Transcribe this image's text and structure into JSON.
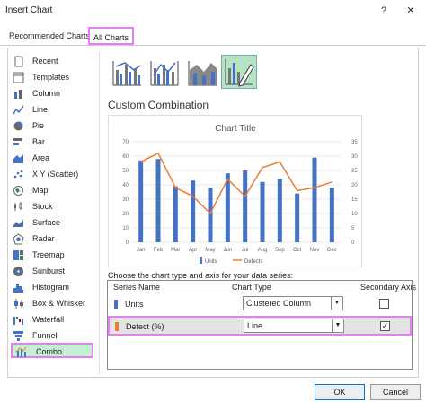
{
  "window": {
    "title": "Insert Chart",
    "help_label": "?",
    "close_label": "✕"
  },
  "tabs": [
    {
      "label": "Recommended Charts",
      "active": false
    },
    {
      "label": "All Charts",
      "active": true
    }
  ],
  "sidebar": {
    "items": [
      {
        "label": "Recent",
        "icon": "recent-icon"
      },
      {
        "label": "Templates",
        "icon": "templates-icon"
      },
      {
        "label": "Column",
        "icon": "column-chart-icon"
      },
      {
        "label": "Line",
        "icon": "line-chart-icon"
      },
      {
        "label": "Pie",
        "icon": "pie-chart-icon"
      },
      {
        "label": "Bar",
        "icon": "bar-chart-icon"
      },
      {
        "label": "Area",
        "icon": "area-chart-icon"
      },
      {
        "label": "X Y (Scatter)",
        "icon": "scatter-chart-icon"
      },
      {
        "label": "Map",
        "icon": "map-chart-icon"
      },
      {
        "label": "Stock",
        "icon": "stock-chart-icon"
      },
      {
        "label": "Surface",
        "icon": "surface-chart-icon"
      },
      {
        "label": "Radar",
        "icon": "radar-chart-icon"
      },
      {
        "label": "Treemap",
        "icon": "treemap-chart-icon"
      },
      {
        "label": "Sunburst",
        "icon": "sunburst-chart-icon"
      },
      {
        "label": "Histogram",
        "icon": "histogram-chart-icon"
      },
      {
        "label": "Box & Whisker",
        "icon": "box-whisker-chart-icon"
      },
      {
        "label": "Waterfall",
        "icon": "waterfall-chart-icon"
      },
      {
        "label": "Funnel",
        "icon": "funnel-chart-icon"
      },
      {
        "label": "Combo",
        "icon": "combo-chart-icon",
        "selected": true
      }
    ]
  },
  "subtypes": {
    "items": [
      "clustered-column-line-icon",
      "clustered-column-line-secondary-icon",
      "stacked-area-column-icon",
      "custom-combination-icon"
    ],
    "selected_index": 3
  },
  "main": {
    "heading": "Custom Combination",
    "series_prompt": "Choose the chart type and axis for your data series:",
    "columns": {
      "series": "Series Name",
      "type": "Chart Type",
      "axis": "Secondary Axis"
    },
    "rows": [
      {
        "name": "Units",
        "color": "#4472c4",
        "chart_type": "Clustered Column",
        "secondary_axis": false,
        "check_glyph": ""
      },
      {
        "name": "Defect (%)",
        "color": "#ed7d31",
        "chart_type": "Line",
        "secondary_axis": true,
        "check_glyph": "✓",
        "selected": true
      }
    ]
  },
  "buttons": {
    "ok": "OK",
    "cancel": "Cancel"
  },
  "chart_data": {
    "type": "bar",
    "title": "Chart Title",
    "categories": [
      "Jan",
      "Feb",
      "Mar",
      "Apr",
      "May",
      "Jun",
      "Jul",
      "Aug",
      "Sep",
      "Oct",
      "Nov",
      "Dec"
    ],
    "series": [
      {
        "name": "Units",
        "type": "bar",
        "axis": "primary",
        "color": "#4472c4",
        "values": [
          57,
          58,
          39,
          43,
          38,
          48,
          50,
          42,
          44,
          34,
          59,
          38
        ]
      },
      {
        "name": "Defects",
        "type": "line",
        "axis": "secondary",
        "color": "#ed7d31",
        "values": [
          28,
          31,
          19,
          16,
          10,
          22,
          16,
          26,
          28,
          18,
          19,
          21
        ]
      }
    ],
    "ylim": [
      0,
      70
    ],
    "y_ticks": [
      0,
      10,
      20,
      30,
      40,
      50,
      60,
      70
    ],
    "y2lim": [
      0,
      35
    ],
    "y2_ticks": [
      0,
      5,
      10,
      15,
      20,
      25,
      30,
      35
    ],
    "legend_position": "bottom",
    "grid": true
  }
}
